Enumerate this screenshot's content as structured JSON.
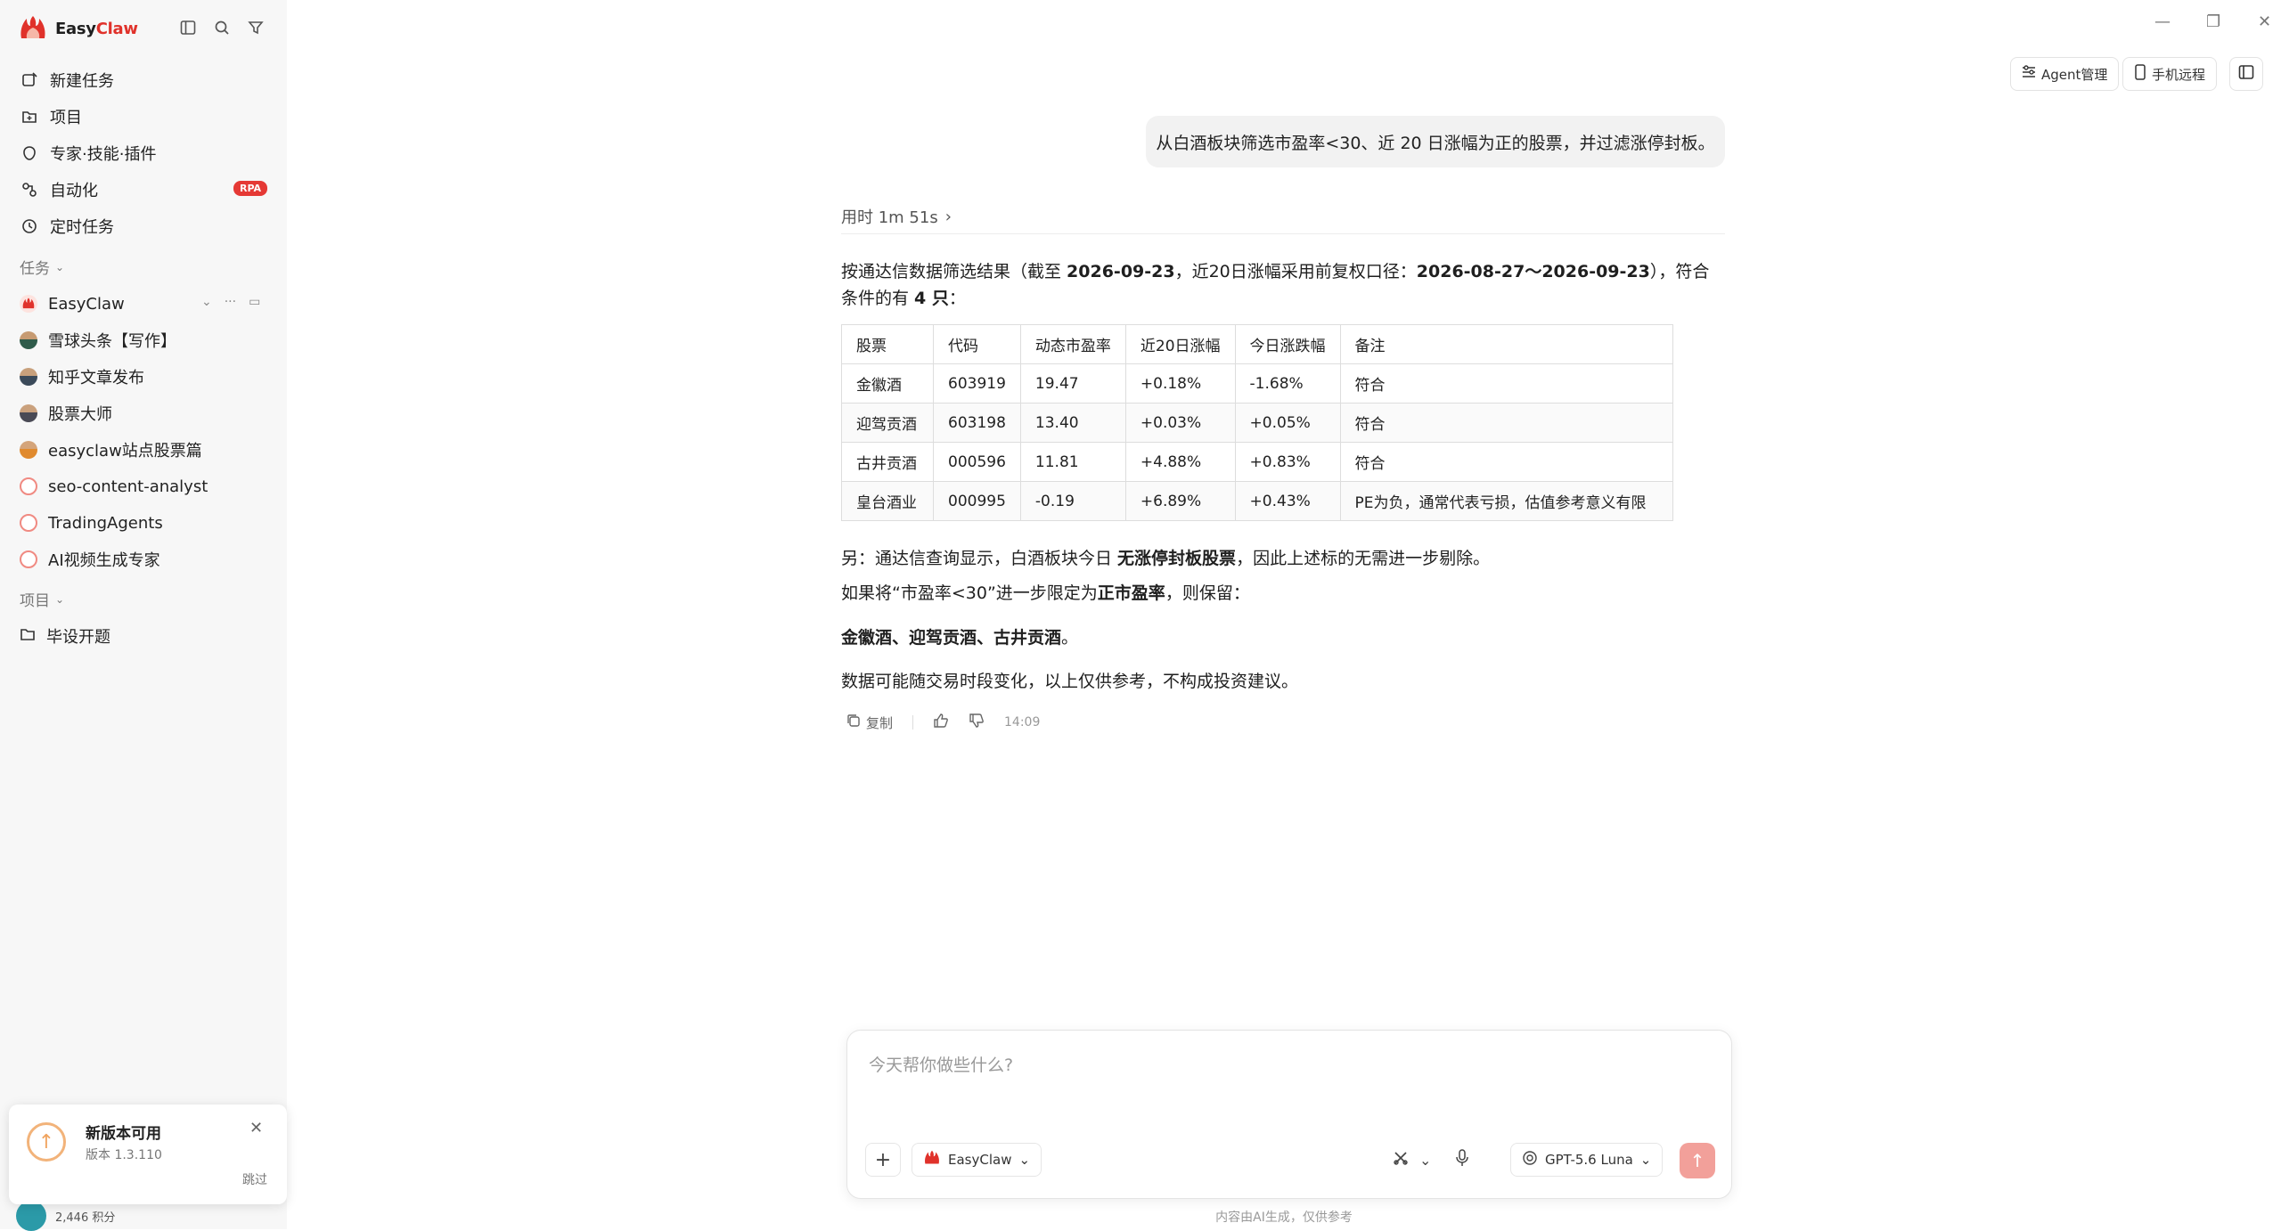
{
  "brand": {
    "name_a": "Easy",
    "name_b": "Claw"
  },
  "nav": [
    {
      "label": "新建任务",
      "icon": "new-task-icon"
    },
    {
      "label": "项目",
      "icon": "folder-icon"
    },
    {
      "label": "专家·技能·插件",
      "icon": "plugin-icon"
    },
    {
      "label": "自动化",
      "icon": "automation-icon",
      "badge": "RPA"
    },
    {
      "label": "定时任务",
      "icon": "clock-icon"
    }
  ],
  "sections": {
    "tasks": "任务",
    "projects": "项目"
  },
  "tasks": [
    {
      "label": "EasyClaw"
    },
    {
      "label": "雪球头条【写作】"
    },
    {
      "label": "知乎文章发布"
    },
    {
      "label": "股票大师"
    },
    {
      "label": "easyclaw站点股票篇"
    },
    {
      "label": "seo-content-analyst"
    },
    {
      "label": "TradingAgents"
    },
    {
      "label": "AI视频生成专家"
    }
  ],
  "projects": [
    {
      "label": "毕设开题"
    }
  ],
  "update": {
    "title": "新版本可用",
    "version": "版本 1.3.110",
    "skip": "跳过"
  },
  "points": "2,446 积分",
  "topbar": {
    "agent_mgmt": "Agent管理",
    "mobile_remote": "手机远程"
  },
  "chat": {
    "user_message": "从白酒板块筛选市盈率<30、近 20 日涨幅为正的股票，并过滤涨停封板。",
    "elapsed": "用时 1m 51s",
    "intro_a": "按通达信数据筛选结果（截至 ",
    "intro_date": "2026-09-23",
    "intro_b": "，近20日涨幅采用前复权口径：",
    "intro_range": "2026-08-27～2026-09-23",
    "intro_c": "），符合条件的有 ",
    "intro_count": "4 只",
    "intro_d": "：",
    "table": {
      "headers": [
        "股票",
        "代码",
        "动态市盈率",
        "近20日涨幅",
        "今日涨跌幅",
        "备注"
      ],
      "rows": [
        [
          "金徽酒",
          "603919",
          "19.47",
          "+0.18%",
          "-1.68%",
          "符合"
        ],
        [
          "迎驾贡酒",
          "603198",
          "13.40",
          "+0.03%",
          "+0.05%",
          "符合"
        ],
        [
          "古井贡酒",
          "000596",
          "11.81",
          "+4.88%",
          "+0.83%",
          "符合"
        ],
        [
          "皇台酒业",
          "000995",
          "-0.19",
          "+6.89%",
          "+0.43%",
          "PE为负，通常代表亏损，估值参考意义有限"
        ]
      ]
    },
    "p1_a": "另：通达信查询显示，白酒板块今日 ",
    "p1_b": "无涨停封板股票",
    "p1_c": "，因此上述标的无需进一步剔除。",
    "p2_a": "如果将“市盈率<30”进一步限定为",
    "p2_b": "正市盈率",
    "p2_c": "，则保留：",
    "p3_b": "金徽酒、迎驾贡酒、古井贡酒",
    "p3_c": "。",
    "p4": "数据可能随交易时段变化，以上仅供参考，不构成投资建议。",
    "copy": "复制",
    "time": "14:09"
  },
  "composer": {
    "placeholder": "今天帮你做些什么?",
    "agent": "EasyClaw",
    "model": "GPT-5.6 Luna"
  },
  "footer": "内容由AI生成，仅供参考"
}
